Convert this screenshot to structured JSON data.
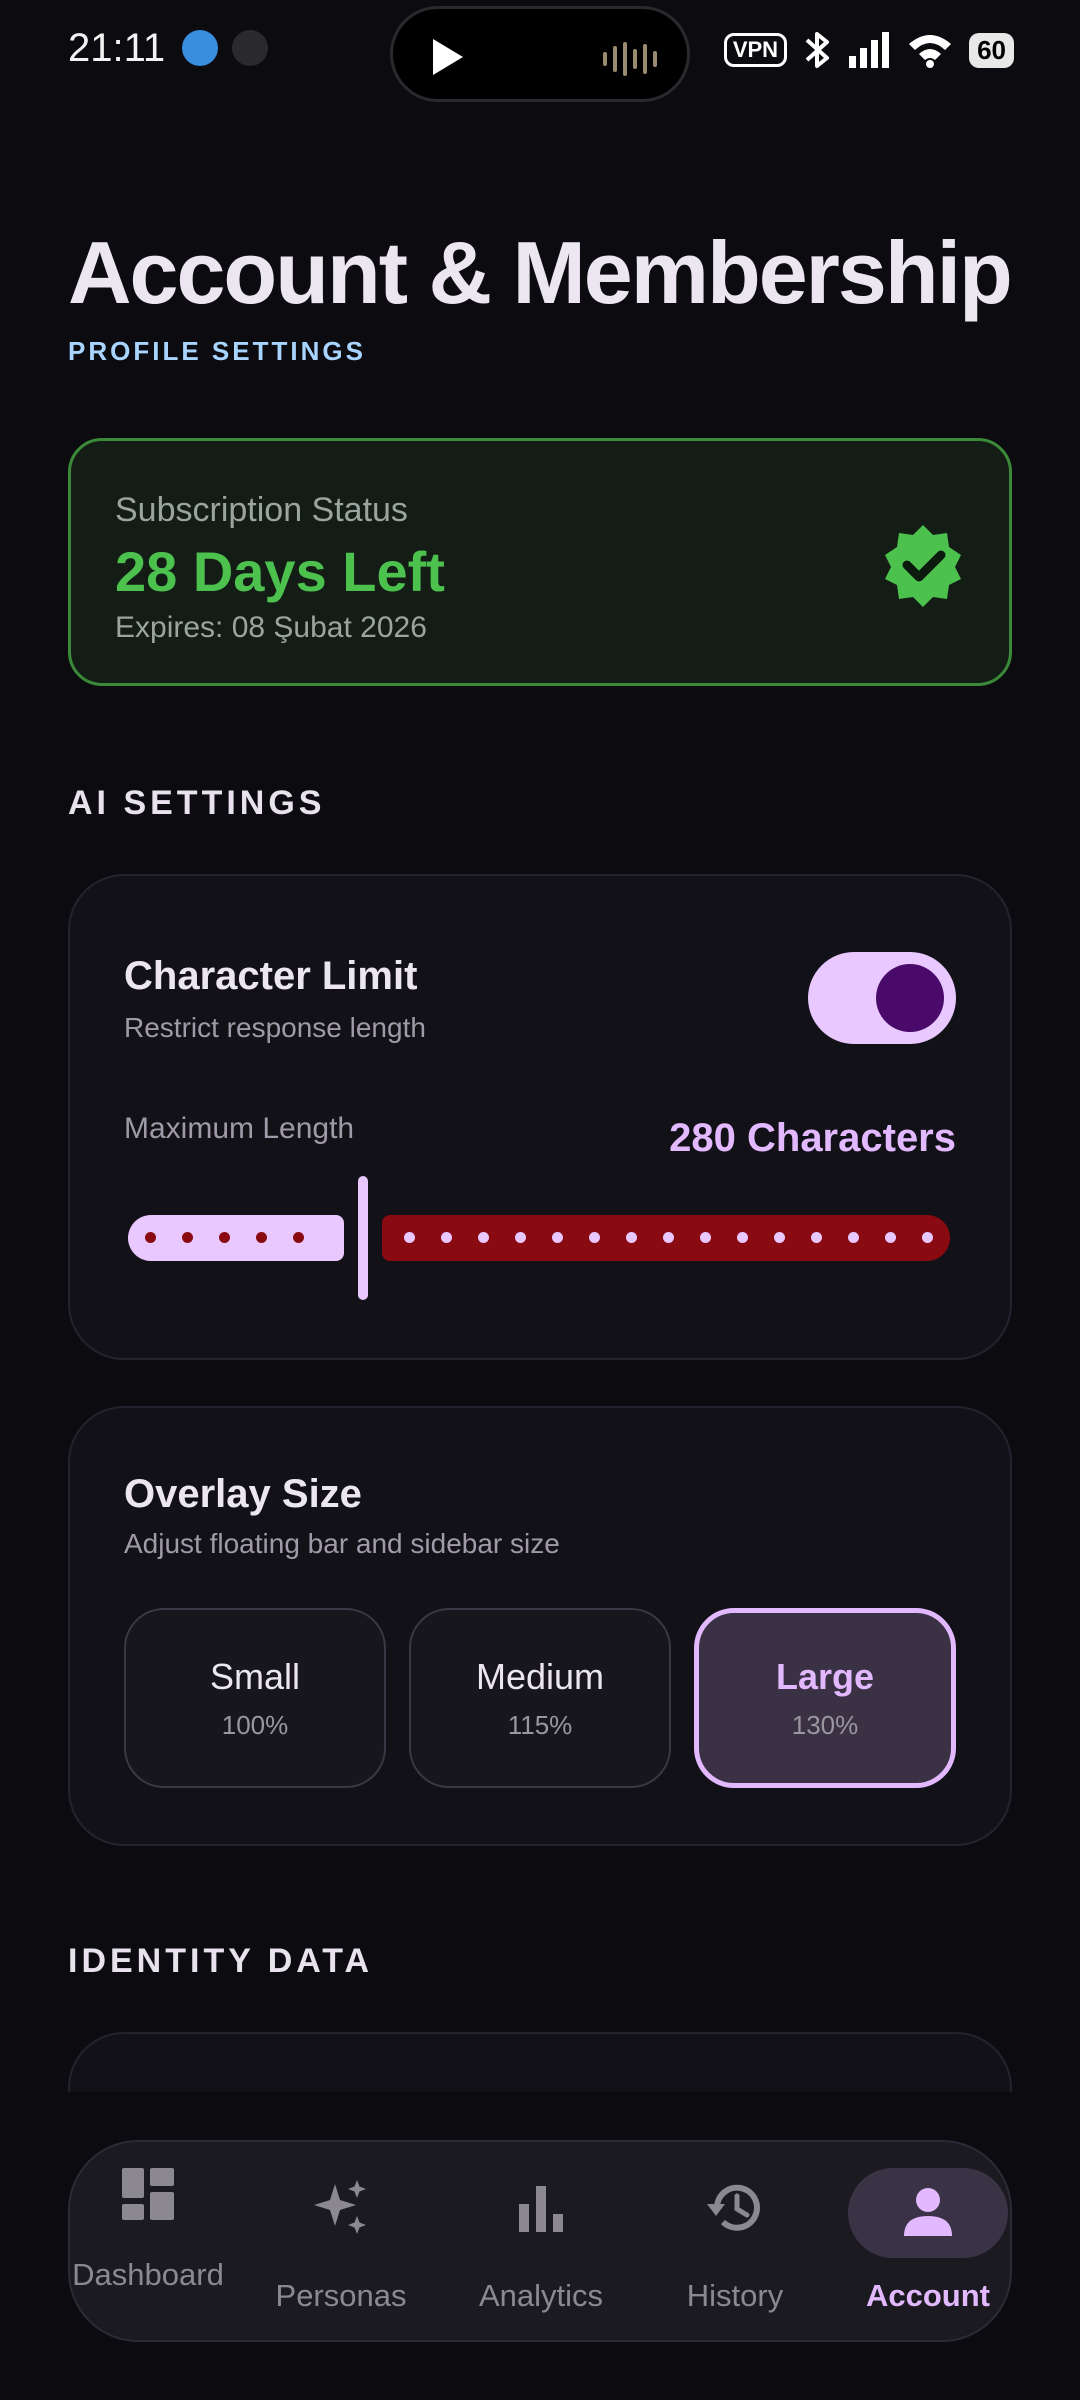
{
  "status_bar": {
    "time": "21:11",
    "vpn": "VPN",
    "battery": "60"
  },
  "header": {
    "title": "Account & Membership",
    "subtitle": "PROFILE SETTINGS"
  },
  "subscription": {
    "label": "Subscription Status",
    "days_left": "28 Days Left",
    "expires": "Expires: 08 Şubat 2026",
    "status_color": "#4cc14e"
  },
  "ai_settings": {
    "section_title": "AI SETTINGS",
    "character_limit": {
      "title": "Character Limit",
      "description": "Restrict response length",
      "enabled": true,
      "max_label": "Maximum Length",
      "value_label": "280 Characters",
      "slider_fraction": 0.28
    },
    "overlay_size": {
      "title": "Overlay Size",
      "description": "Adjust floating bar and sidebar size",
      "options": [
        {
          "name": "Small",
          "percent": "100%"
        },
        {
          "name": "Medium",
          "percent": "115%"
        },
        {
          "name": "Large",
          "percent": "130%"
        }
      ],
      "selected": "Large"
    }
  },
  "identity": {
    "section_title": "IDENTITY DATA"
  },
  "nav": {
    "items": [
      {
        "label": "Dashboard",
        "icon": "dashboard-icon"
      },
      {
        "label": "Personas",
        "icon": "sparkle-icon"
      },
      {
        "label": "Analytics",
        "icon": "bar-chart-icon"
      },
      {
        "label": "History",
        "icon": "history-icon"
      },
      {
        "label": "Account",
        "icon": "person-icon"
      }
    ],
    "active": "Account"
  },
  "colors": {
    "accent": "#e2b8ff",
    "success": "#4cc14e",
    "slider_inactive": "#8a0a12"
  }
}
